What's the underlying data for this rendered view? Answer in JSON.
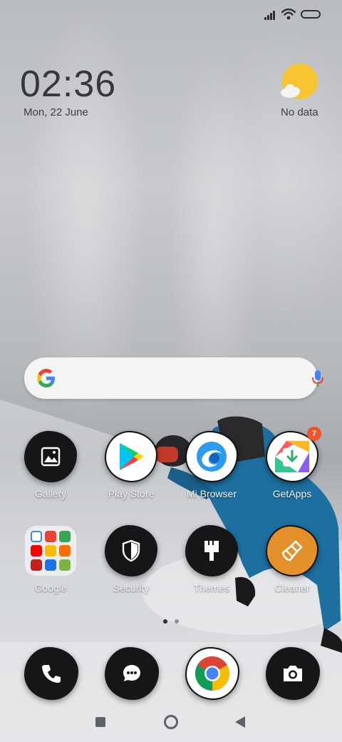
{
  "clock": {
    "time": "02:36",
    "date": "Mon, 22 June"
  },
  "weather": {
    "text": "No data",
    "icon": "sun-cloud-icon"
  },
  "search": {
    "icon": "google-g-icon",
    "mic_icon": "mic-icon"
  },
  "apps_row1": [
    {
      "label": "Gallery",
      "icon": "gallery-icon"
    },
    {
      "label": "Play Store",
      "icon": "play-store-icon"
    },
    {
      "label": "Mi Browser",
      "icon": "browser-icon"
    },
    {
      "label": "GetApps",
      "icon": "getapps-icon",
      "badge": "7"
    }
  ],
  "apps_row2": [
    {
      "label": "Google",
      "icon": "google-folder-icon"
    },
    {
      "label": "Security",
      "icon": "shield-icon"
    },
    {
      "label": "Themes",
      "icon": "brush-icon"
    },
    {
      "label": "Cleaner",
      "icon": "broom-icon"
    }
  ],
  "dock": [
    {
      "icon": "phone-icon"
    },
    {
      "icon": "messages-icon"
    },
    {
      "icon": "chrome-icon"
    },
    {
      "icon": "camera-icon"
    }
  ],
  "page_indicator": {
    "pages": 2,
    "current": 1
  },
  "colors": {
    "accent_orange": "#e3902b",
    "badge": "#f0542a",
    "sun": "#f7c532"
  }
}
